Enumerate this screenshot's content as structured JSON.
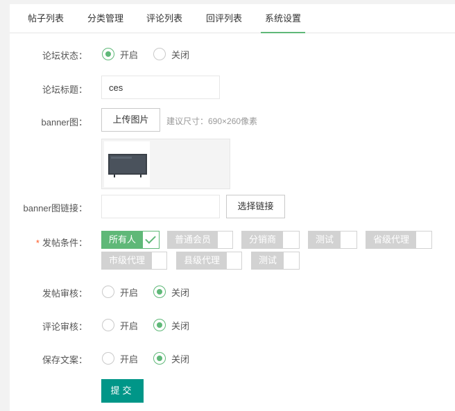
{
  "tabs": [
    {
      "label": "帖子列表"
    },
    {
      "label": "分类管理"
    },
    {
      "label": "评论列表"
    },
    {
      "label": "回评列表"
    },
    {
      "label": "系统设置"
    }
  ],
  "form": {
    "forum_status": {
      "label": "论坛状态：",
      "options": [
        "开启",
        "关闭"
      ],
      "selected": "开启"
    },
    "forum_title": {
      "label": "论坛标题：",
      "value": "ces"
    },
    "banner": {
      "label": "banner图：",
      "upload_button": "上传图片",
      "hint": "建议尺寸：690×260像素"
    },
    "banner_link": {
      "label": "banner图链接：",
      "value": "",
      "button": "选择链接"
    },
    "post_condition": {
      "required_mark": "*",
      "label": "发帖条件：",
      "options": [
        {
          "label": "所有人",
          "checked": true
        },
        {
          "label": "普通会员",
          "checked": false
        },
        {
          "label": "分销商",
          "checked": false
        },
        {
          "label": "测试",
          "checked": false
        },
        {
          "label": "省级代理",
          "checked": false
        },
        {
          "label": "市级代理",
          "checked": false
        },
        {
          "label": "县级代理",
          "checked": false
        },
        {
          "label": "测试",
          "checked": false
        }
      ]
    },
    "post_review": {
      "label": "发帖审核：",
      "options": [
        "开启",
        "关闭"
      ],
      "selected": "关闭"
    },
    "comment_review": {
      "label": "评论审核：",
      "options": [
        "开启",
        "关闭"
      ],
      "selected": "关闭"
    },
    "save_copy": {
      "label": "保存文案：",
      "options": [
        "开启",
        "关闭"
      ],
      "selected": "关闭"
    },
    "submit_label": "提交"
  },
  "colors": {
    "accent": "#5fb878",
    "submit": "#009688",
    "tag_off": "#d2d2d2"
  }
}
